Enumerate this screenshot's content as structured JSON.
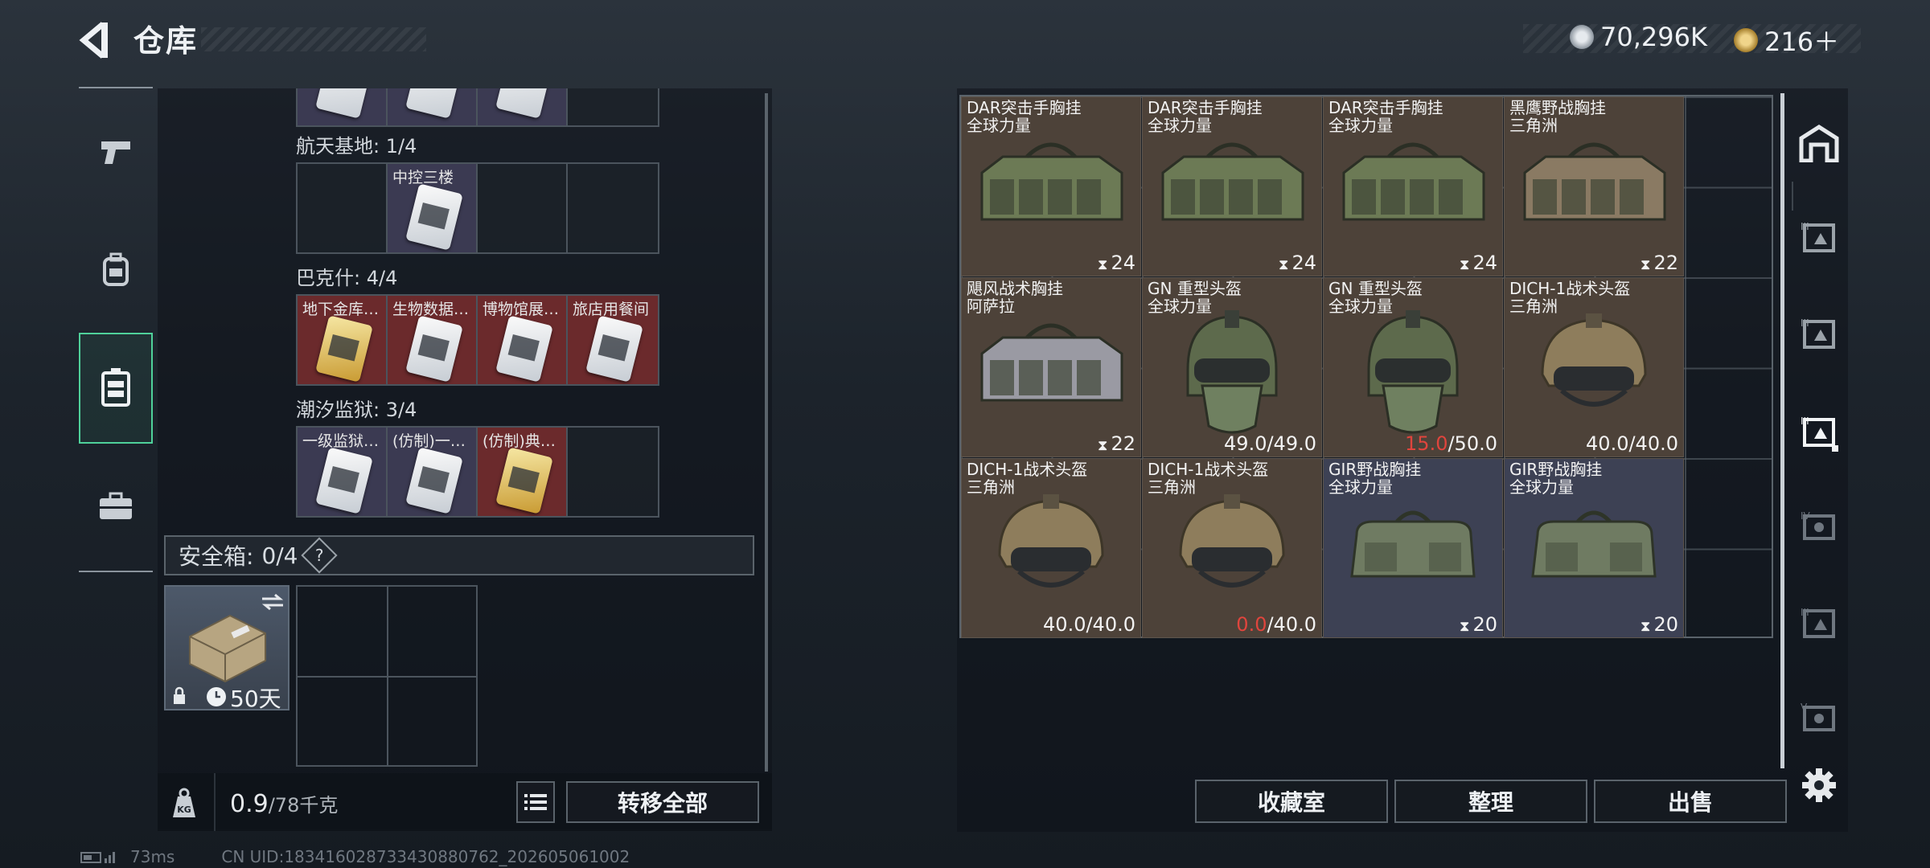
{
  "header": {
    "title": "仓库",
    "currency_1": "70,296K",
    "currency_2": "216＋"
  },
  "left_nav": {
    "items": [
      {
        "icon": "pistol-icon"
      },
      {
        "icon": "backpack-icon"
      },
      {
        "icon": "vest-icon",
        "active": true
      },
      {
        "icon": "briefcase-icon"
      }
    ]
  },
  "keycard_groups": [
    {
      "title": "航天基地: 1/4",
      "slots": [
        {
          "label": "",
          "tone": "empty"
        },
        {
          "label": "中控三楼",
          "tone": "purple"
        },
        {
          "label": "",
          "tone": "empty"
        },
        {
          "label": "",
          "tone": "empty"
        }
      ]
    },
    {
      "title": "巴克什: 4/4",
      "slots": [
        {
          "label": "地下金库…",
          "tone": "red"
        },
        {
          "label": "生物数据…",
          "tone": "red"
        },
        {
          "label": "博物馆展…",
          "tone": "red"
        },
        {
          "label": "旅店用餐间",
          "tone": "red"
        }
      ]
    },
    {
      "title": "潮汐监狱: 3/4",
      "slots": [
        {
          "label": "一级监狱…",
          "tone": "purple"
        },
        {
          "label": "(仿制)一…",
          "tone": "purple"
        },
        {
          "label": "(仿制)典…",
          "tone": "red"
        },
        {
          "label": "",
          "tone": "empty"
        }
      ]
    }
  ],
  "safe_box": {
    "label": "安全箱:",
    "count": "0/4",
    "help": "?",
    "timer": "50天"
  },
  "weight": {
    "current": "0.9",
    "max": "/78千克",
    "unit_icon": "KG"
  },
  "buttons": {
    "transfer_all": "转移全部",
    "collection": "收藏室",
    "organize": "整理",
    "sell": "出售"
  },
  "items": [
    {
      "name": "DAR突击手胸挂\n全球力量",
      "value": "24",
      "kind": "rig",
      "tone": "brown",
      "color": "#6c7a55"
    },
    {
      "name": "DAR突击手胸挂\n全球力量",
      "value": "24",
      "kind": "rig",
      "tone": "brown",
      "color": "#6c7a55"
    },
    {
      "name": "DAR突击手胸挂\n全球力量",
      "value": "24",
      "kind": "rig",
      "tone": "brown",
      "color": "#6c7a55"
    },
    {
      "name": "黑鹰野战胸挂\n三角洲",
      "value": "22",
      "kind": "rig",
      "tone": "brown",
      "color": "#8a7a63"
    },
    {
      "name": "飓风战术胸挂\n阿萨拉",
      "value": "22",
      "kind": "rig",
      "tone": "brown",
      "color": "#9a9aa3"
    },
    {
      "name": "GN 重型头盔\n全球力量",
      "dur_cur": "49.0",
      "dur_max": "/49.0",
      "low": false,
      "kind": "heavy-helmet",
      "tone": "brown",
      "color": "#5d6a4c"
    },
    {
      "name": "GN 重型头盔\n全球力量",
      "dur_cur": "15.0",
      "dur_max": "/50.0",
      "low": true,
      "kind": "heavy-helmet",
      "tone": "brown",
      "color": "#5d6a4c"
    },
    {
      "name": "DICH-1战术头盔\n三角洲",
      "dur_cur": "40.0",
      "dur_max": "/40.0",
      "low": false,
      "kind": "helmet",
      "tone": "brown",
      "color": "#8e7d5c"
    },
    {
      "name": "DICH-1战术头盔\n三角洲",
      "dur_cur": "40.0",
      "dur_max": "/40.0",
      "low": false,
      "kind": "helmet",
      "tone": "brown",
      "color": "#8e7d5c"
    },
    {
      "name": "DICH-1战术头盔\n三角洲",
      "dur_cur": "0.0",
      "dur_max": "/40.0",
      "low": true,
      "kind": "helmet",
      "tone": "brown",
      "color": "#8e7d5c"
    },
    {
      "name": "GIR野战胸挂\n全球力量",
      "value": "20",
      "kind": "bag",
      "tone": "blue",
      "color": "#6f7b62"
    },
    {
      "name": "GIR野战胸挂\n全球力量",
      "value": "20",
      "kind": "bag",
      "tone": "blue",
      "color": "#6f7b62"
    }
  ],
  "status": {
    "ping": "73ms",
    "uid": "CN UID:183416028733430880762_202605061002"
  }
}
